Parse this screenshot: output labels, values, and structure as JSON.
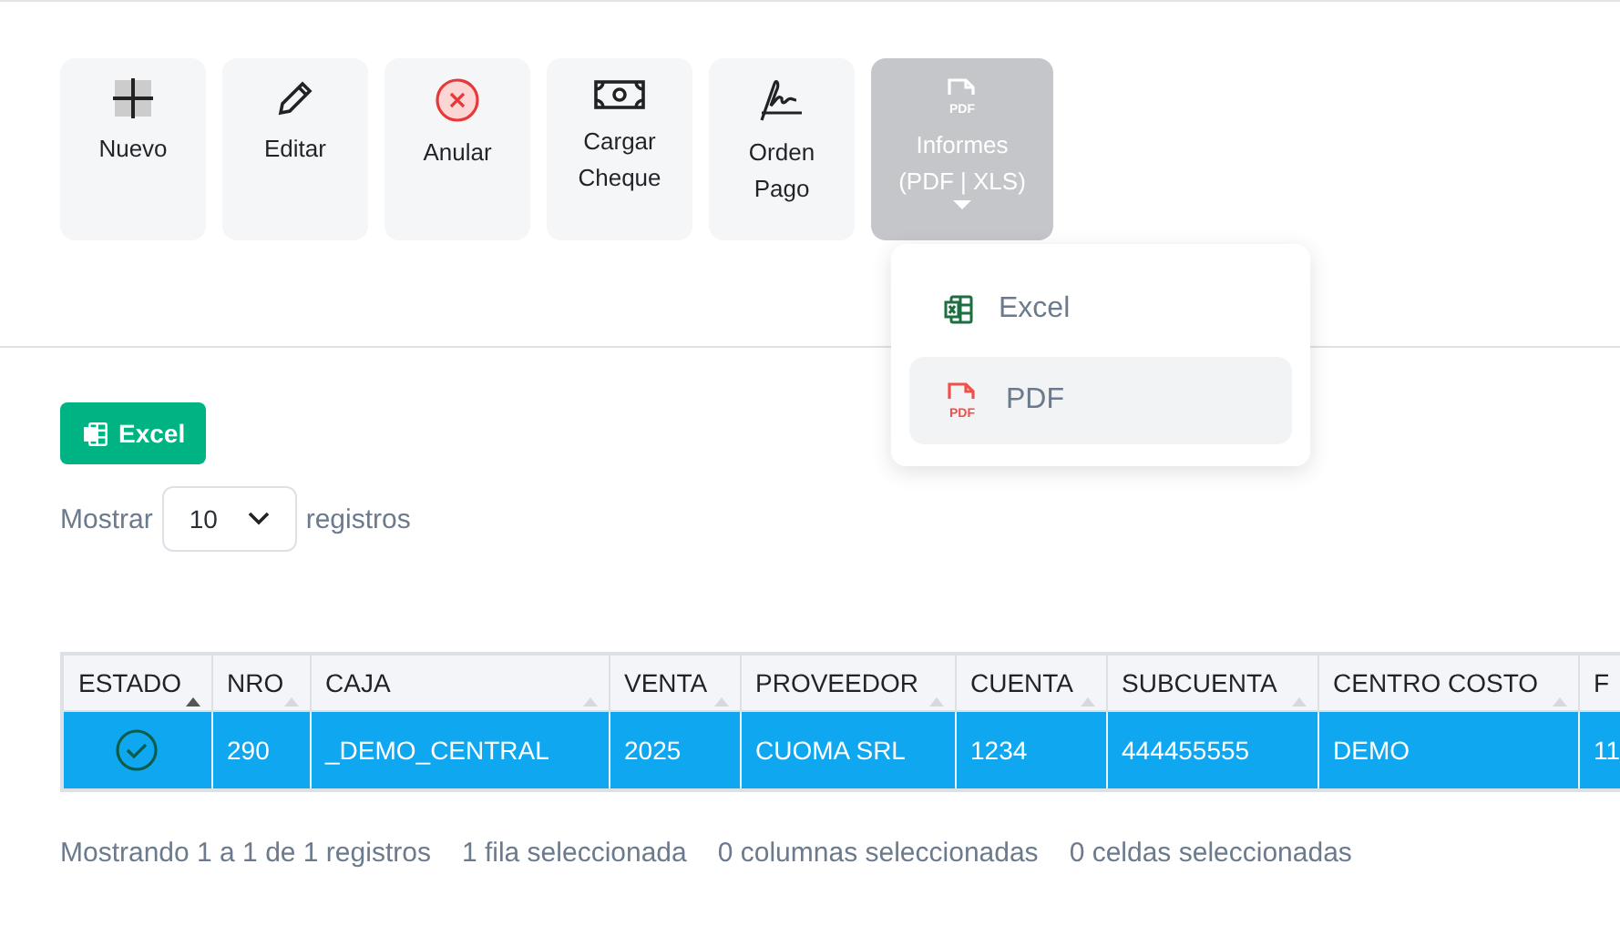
{
  "toolbar": [
    {
      "kind": "plus",
      "label": "Nuevo",
      "active": false,
      "caret": false
    },
    {
      "kind": "pencil",
      "label": "Editar",
      "active": false,
      "caret": false
    },
    {
      "kind": "cancel",
      "label": "Anular",
      "active": false,
      "caret": false
    },
    {
      "kind": "money",
      "label": "Cargar Cheque",
      "active": false,
      "caret": false
    },
    {
      "kind": "signature",
      "label": "Orden Pago",
      "active": false,
      "caret": false
    },
    {
      "kind": "pdf",
      "label": "Informes (PDF | XLS)",
      "icon_text": "PDF",
      "active": true,
      "caret": true
    }
  ],
  "dropdown": {
    "open": true,
    "items": [
      {
        "kind": "excel",
        "label": "Excel",
        "selected": false
      },
      {
        "kind": "pdf",
        "label": "PDF",
        "icon_text": "PDF",
        "selected": true
      }
    ]
  },
  "export_button": {
    "label": "Excel"
  },
  "page_length": {
    "prefix": "Mostrar",
    "value": "10",
    "suffix": "registros"
  },
  "table": {
    "columns": [
      {
        "label": "ESTADO",
        "sorted": true
      },
      {
        "label": "NRO",
        "sorted": false
      },
      {
        "label": "CAJA",
        "sorted": false
      },
      {
        "label": "VENTA",
        "sorted": false
      },
      {
        "label": "PROVEEDOR",
        "sorted": false
      },
      {
        "label": "CUENTA",
        "sorted": false
      },
      {
        "label": "SUBCUENTA",
        "sorted": false
      },
      {
        "label": "CENTRO COSTO",
        "sorted": false
      },
      {
        "label": "F"
      }
    ],
    "rows": [
      {
        "selected": true,
        "estado_ok": true,
        "cells": [
          "",
          "290",
          "_DEMO_CENTRAL",
          "2025",
          "CUOMA SRL",
          "1234",
          "444455555",
          "DEMO",
          "11"
        ]
      }
    ]
  },
  "info": [
    "Mostrando 1 a 1 de 1 registros",
    "1 fila seleccionada",
    "0 columnas seleccionadas",
    "0 celdas seleccionadas"
  ]
}
